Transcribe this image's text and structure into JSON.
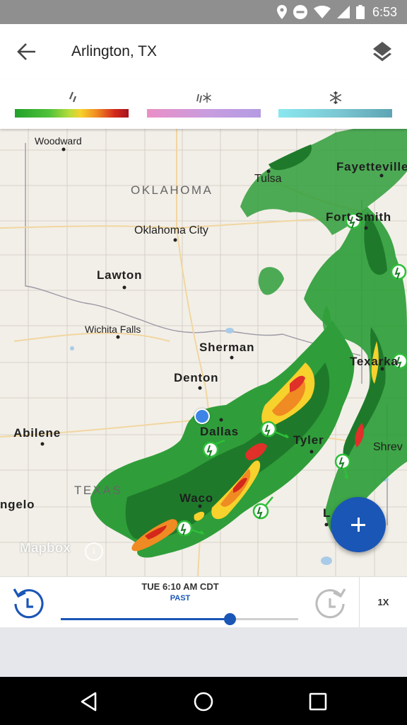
{
  "status_bar": {
    "time": "6:53",
    "icons": [
      "location-icon",
      "do-not-disturb-icon",
      "wifi-icon",
      "cell-signal-icon",
      "battery-icon"
    ]
  },
  "header": {
    "title": "Arlington, TX",
    "back_icon": "arrow-back-icon",
    "layers_icon": "layers-icon"
  },
  "legend": {
    "items": [
      {
        "name": "rain",
        "icon": "rain-icon",
        "colors": [
          "#22a02a",
          "#f7d12c",
          "#a4141c"
        ]
      },
      {
        "name": "mix",
        "icon": "mix-icon",
        "colors": [
          "#ea8fc6",
          "#b49be3"
        ]
      },
      {
        "name": "snow",
        "icon": "snowflake-icon",
        "colors": [
          "#8ae8ef",
          "#5fa4b4"
        ]
      }
    ]
  },
  "map": {
    "states": [
      "OKLAHOMA",
      "TEXAS"
    ],
    "cities": [
      "Woodward",
      "Tulsa",
      "Fayetteville",
      "Fort Smith",
      "Oklahoma City",
      "Lawton",
      "Wichita Falls",
      "Sherman",
      "Texarka",
      "Denton",
      "Dallas",
      "Abilene",
      "Tyler",
      "Shrev",
      "Waco",
      "ngelo",
      "L"
    ],
    "attribution": "Mapbox",
    "info_glyph": "i"
  },
  "timeline": {
    "time": "TUE 6:10 AM CDT",
    "state": "PAST",
    "progress": 0.71,
    "speed": "1X"
  },
  "colors": {
    "accent": "#1a56b6",
    "user_location": "#3d84e6",
    "radar_green": "#2f9e3a",
    "radar_red": "#c8281b"
  }
}
